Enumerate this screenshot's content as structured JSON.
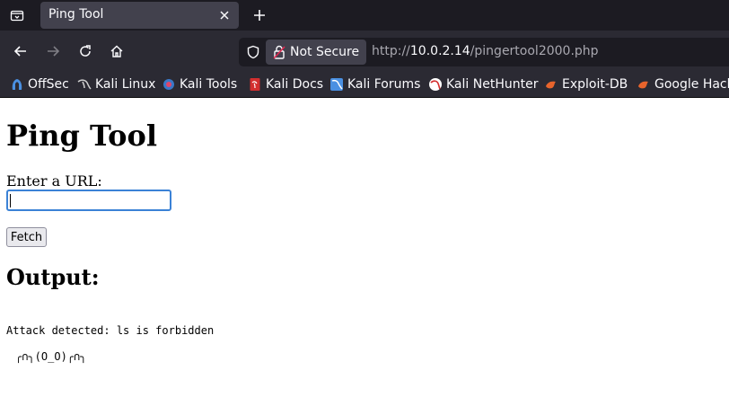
{
  "browser": {
    "tab": {
      "title": "Ping Tool"
    },
    "security_label": "Not Secure",
    "url": {
      "prefix": "http://",
      "host": "10.0.2.14",
      "path": "/pingertool2000.php"
    },
    "bookmarks": [
      {
        "label": "OffSec",
        "icon": "offsec-icon",
        "color": "#4a90e2"
      },
      {
        "label": "Kali Linux",
        "icon": "kali-dragon-icon",
        "color": "#cfcfcf"
      },
      {
        "label": "Kali Tools",
        "icon": "kali-tools-icon",
        "color": "#e0466a"
      },
      {
        "label": "Kali Docs",
        "icon": "kali-docs-icon",
        "color": "#d32f2f"
      },
      {
        "label": "Kali Forums",
        "icon": "kali-forums-icon",
        "color": "#4a90e2"
      },
      {
        "label": "Kali NetHunter",
        "icon": "nethunter-icon",
        "color": "#d32f2f"
      },
      {
        "label": "Exploit-DB",
        "icon": "exploit-db-icon",
        "color": "#e8642c"
      },
      {
        "label": "Google Hacking DB",
        "icon": "ghdb-icon",
        "color": "#e8642c"
      }
    ]
  },
  "page": {
    "title": "Ping Tool",
    "input_label": "Enter a URL:",
    "input_value": "",
    "fetch_label": "Fetch",
    "output_heading": "Output:",
    "output_text": "Attack detected: ls is forbidden",
    "kaomoji": "╭∩╮(O_O)╭∩╮"
  }
}
